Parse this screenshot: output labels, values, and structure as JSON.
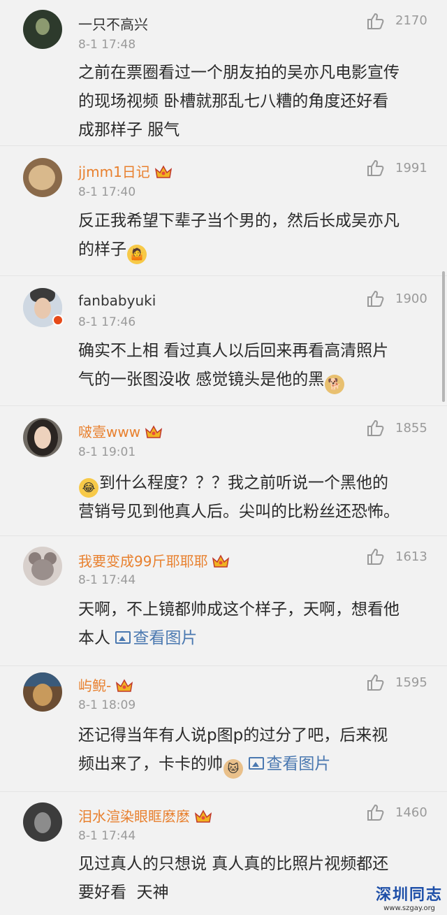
{
  "comments": [
    {
      "name": "一只不高兴",
      "time": "8-1 17:48",
      "likes": "2170",
      "vip": false,
      "lines": [
        "之前在票圈看过一个朋友拍的吴亦凡电影宣传",
        "的现场视频 卧槽就那乱七八糟的角度还好看",
        "成那样子 服气"
      ]
    },
    {
      "name": "jjmm1日记",
      "time": "8-1 17:40",
      "likes": "1991",
      "vip": true,
      "lines": [
        "反正我希望下辈子当个男的，然后长成吴亦凡",
        "的样子"
      ]
    },
    {
      "name": "fanbabyuki",
      "time": "8-1 17:46",
      "likes": "1900",
      "vip": false,
      "lines": [
        "确实不上相 看过真人以后回来再看高清照片",
        "气的一张图没收 感觉镜头是他的黑"
      ]
    },
    {
      "name": "啵壹www",
      "time": "8-1 19:01",
      "likes": "1855",
      "vip": true,
      "lines": [
        "到什么程度？？？我之前听说一个黑他的",
        "营销号见到他真人后。尖叫的比粉丝还恐怖。"
      ]
    },
    {
      "name": "我要变成99斤耶耶耶",
      "time": "8-1 17:44",
      "likes": "1613",
      "vip": true,
      "lines": [
        "天啊，不上镜都帅成这个样子，天啊，想看他",
        "本人"
      ],
      "view_pic": "查看图片"
    },
    {
      "name": "屿鲵-",
      "time": "8-1 18:09",
      "likes": "1595",
      "vip": true,
      "lines": [
        "还记得当年有人说p图p的过分了吧，后来视",
        "频出来了，卡卡的帅"
      ],
      "view_pic": "查看图片"
    },
    {
      "name": "泪水渲染眼眶麽麽",
      "time": "8-1 17:44",
      "likes": "1460",
      "vip": true,
      "lines": [
        "见过真人的只想说 真人真的比照片视频都还",
        "要好看  天神"
      ]
    }
  ],
  "watermark": {
    "title": "深圳同志",
    "url": "www.szgay.org"
  },
  "icons": {
    "like": "thumbs-up-icon",
    "crown": "crown-icon",
    "picture": "picture-icon"
  },
  "colors": {
    "vip_name": "#e8802e",
    "link": "#4a78b0",
    "meta": "#9a9a9a"
  }
}
